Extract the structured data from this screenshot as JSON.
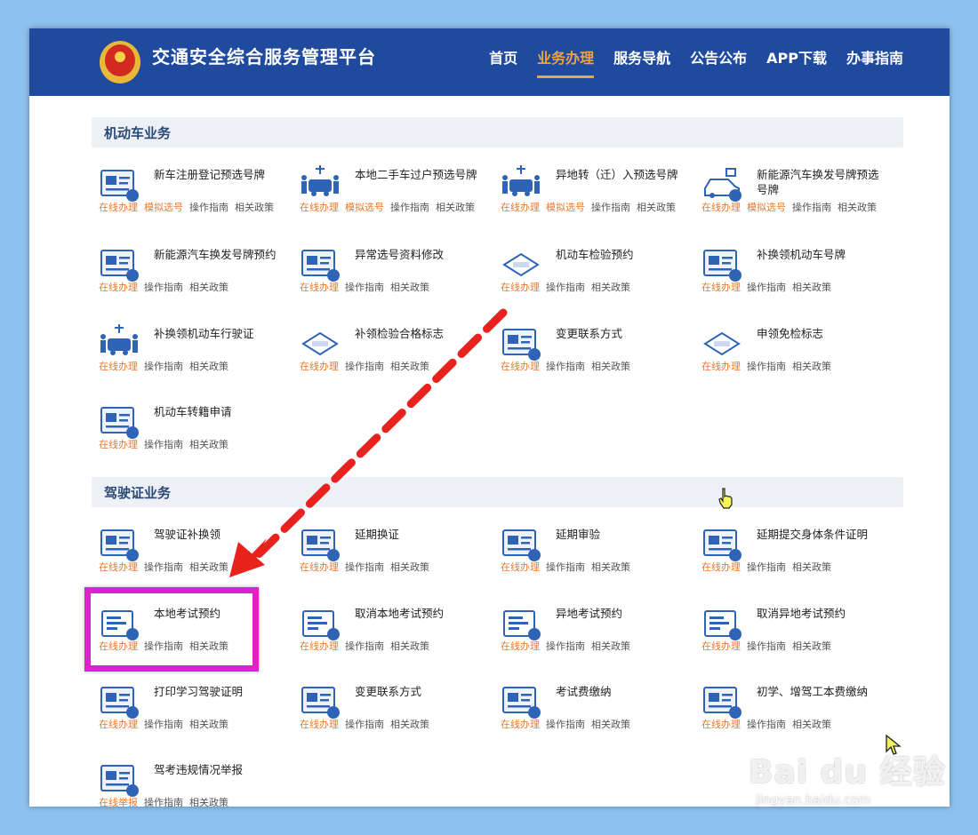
{
  "header": {
    "title": "交通安全综合服务管理平台",
    "nav": [
      "首页",
      "业务办理",
      "服务导航",
      "公告公布",
      "APP下载",
      "办事指南"
    ],
    "active_nav": "业务办理"
  },
  "sections": [
    {
      "title": "机动车业务",
      "items": [
        {
          "name": "新车注册登记预选号牌",
          "icon": "new-plate-icon",
          "links": [
            "在线办理",
            "模拟选号",
            "操作指南",
            "相关政策"
          ]
        },
        {
          "name": "本地二手车过户预选号牌",
          "icon": "transfer-car-icon",
          "links": [
            "在线办理",
            "模拟选号",
            "操作指南",
            "相关政策"
          ]
        },
        {
          "name": "异地转（迁）入预选号牌",
          "icon": "move-in-car-icon",
          "links": [
            "在线办理",
            "模拟选号",
            "操作指南",
            "相关政策"
          ]
        },
        {
          "name": "新能源汽车换发号牌预选号牌",
          "icon": "ev-plate-icon",
          "links": [
            "在线办理",
            "模拟选号",
            "操作指南",
            "相关政策"
          ]
        },
        {
          "name": "新能源汽车换发号牌预约",
          "icon": "ev-appointment-icon",
          "links": [
            "在线办理",
            "操作指南",
            "相关政策"
          ]
        },
        {
          "name": "异常选号资料修改",
          "icon": "plate-edit-icon",
          "links": [
            "在线办理",
            "操作指南",
            "相关政策"
          ]
        },
        {
          "name": "机动车检验预约",
          "icon": "inspection-icon",
          "links": [
            "在线办理",
            "操作指南",
            "相关政策"
          ]
        },
        {
          "name": "补换领机动车号牌",
          "icon": "replace-plate-icon",
          "links": [
            "在线办理",
            "操作指南",
            "相关政策"
          ]
        },
        {
          "name": "补换领机动车行驶证",
          "icon": "license-card-icon",
          "links": [
            "在线办理",
            "操作指南",
            "相关政策"
          ]
        },
        {
          "name": "补领检验合格标志",
          "icon": "inspection-mark-icon",
          "links": [
            "在线办理",
            "操作指南",
            "相关政策"
          ]
        },
        {
          "name": "变更联系方式",
          "icon": "contact-change-icon",
          "links": [
            "在线办理",
            "操作指南",
            "相关政策"
          ]
        },
        {
          "name": "申领免检标志",
          "icon": "exempt-mark-icon",
          "links": [
            "在线办理",
            "操作指南",
            "相关政策"
          ]
        },
        {
          "name": "机动车转籍申请",
          "icon": "registration-transfer-icon",
          "links": [
            "在线办理",
            "操作指南",
            "相关政策"
          ]
        }
      ]
    },
    {
      "title": "驾驶证业务",
      "items": [
        {
          "name": "驾驶证补换领",
          "icon": "driver-license-icon",
          "links": [
            "在线办理",
            "操作指南",
            "相关政策"
          ]
        },
        {
          "name": "延期换证",
          "icon": "extend-renewal-icon",
          "links": [
            "在线办理",
            "操作指南",
            "相关政策"
          ]
        },
        {
          "name": "延期审验",
          "icon": "extend-review-icon",
          "links": [
            "在线办理",
            "操作指南",
            "相关政策"
          ]
        },
        {
          "name": "延期提交身体条件证明",
          "icon": "health-cert-icon",
          "links": [
            "在线办理",
            "操作指南",
            "相关政策"
          ]
        },
        {
          "name": "本地考试预约",
          "icon": "exam-appointment-icon",
          "links": [
            "在线办理",
            "操作指南",
            "相关政策"
          ]
        },
        {
          "name": "取消本地考试预约",
          "icon": "cancel-exam-icon",
          "links": [
            "在线办理",
            "操作指南",
            "相关政策"
          ]
        },
        {
          "name": "异地考试预约",
          "icon": "remote-exam-icon",
          "links": [
            "在线办理",
            "操作指南",
            "相关政策"
          ]
        },
        {
          "name": "取消异地考试预约",
          "icon": "cancel-remote-exam-icon",
          "links": [
            "在线办理",
            "操作指南",
            "相关政策"
          ]
        },
        {
          "name": "打印学习驾驶证明",
          "icon": "print-learner-icon",
          "links": [
            "在线办理",
            "操作指南",
            "相关政策"
          ]
        },
        {
          "name": "变更联系方式",
          "icon": "contact-change-icon",
          "links": [
            "在线办理",
            "操作指南",
            "相关政策"
          ]
        },
        {
          "name": "考试费缴纳",
          "icon": "exam-fee-icon",
          "links": [
            "在线办理",
            "操作指南",
            "相关政策"
          ]
        },
        {
          "name": "初学、增驾工本费缴纳",
          "icon": "cost-fee-icon",
          "links": [
            "在线办理",
            "操作指南",
            "相关政策"
          ]
        },
        {
          "name": "驾考违规情况举报",
          "icon": "report-violation-icon",
          "links": [
            "在线举报",
            "操作指南",
            "相关政策"
          ]
        }
      ]
    }
  ],
  "watermark": {
    "brand": "Bai du 经验",
    "url": "jingyan.baidu.com"
  },
  "colors": {
    "header": "#1f4a9e",
    "accent": "#f3a33c",
    "link_orange": "#e8792e",
    "highlight": "#e020c8",
    "arrow": "#e8231e",
    "icon_blue": "#2e63b6"
  }
}
